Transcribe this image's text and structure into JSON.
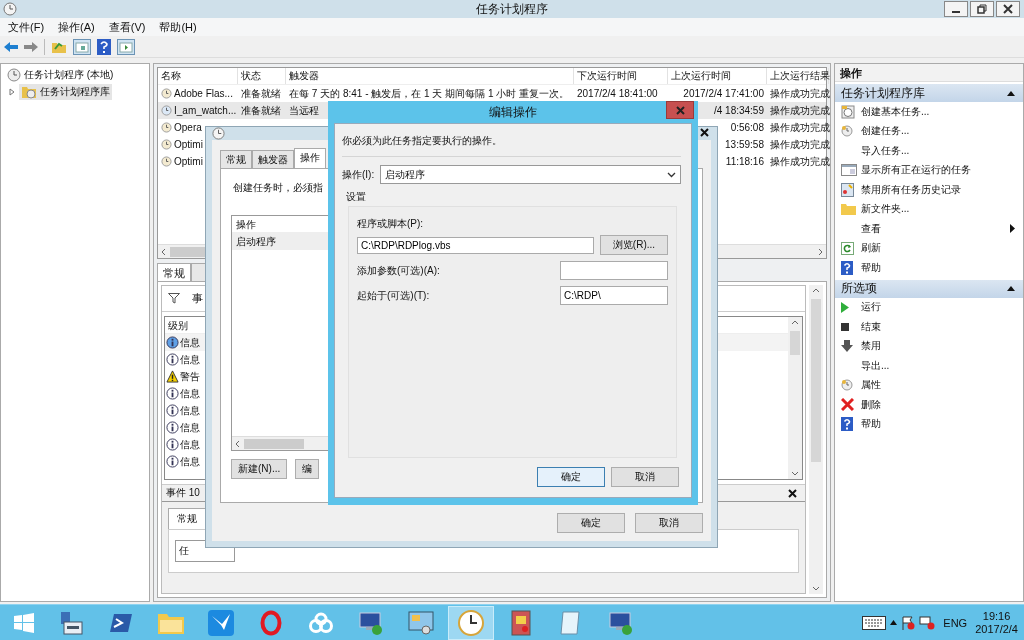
{
  "window": {
    "title": "任务计划程序"
  },
  "menu": [
    "文件(F)",
    "操作(A)",
    "查看(V)",
    "帮助(H)"
  ],
  "tree": [
    {
      "label": "任务计划程序 (本地)",
      "selected": false,
      "children": [
        {
          "label": "任务计划程序库",
          "selected": true,
          "expanded": false
        }
      ]
    }
  ],
  "task_table": {
    "columns": [
      "名称",
      "状态",
      "触发器",
      "下次运行时间",
      "上次运行时间",
      "上次运行结果"
    ],
    "rows": [
      {
        "name": "Adobe Flas...",
        "status": "准备就绪",
        "trigger": "在每 7 天的 8:41 - 触发后，在 1 天 期间每隔 1 小时 重复一次。",
        "next_run": "2017/2/4 18:41:00",
        "last_run": "2017/2/4 17:41:00",
        "result": "操作成功完成",
        "selected": false
      },
      {
        "name": "I_am_watch...",
        "status": "准备就绪",
        "trigger": "当远程",
        "last_run": "/4 18:34:59",
        "result": "操作成功完成",
        "selected": true
      },
      {
        "name": "Opera",
        "last_run": "0:56:08",
        "result": "操作成功完成",
        "selected": false
      },
      {
        "name": "Optimi",
        "last_run": "13:59:58",
        "result": "操作成功完成",
        "selected": false
      },
      {
        "name": "Optimi",
        "last_run": "11:18:16",
        "result": "操作成功完成",
        "selected": false
      }
    ]
  },
  "lower_tabs": [
    {
      "label": "常规",
      "selected": true
    }
  ],
  "events": {
    "title": "事",
    "column": "级别",
    "rows": [
      {
        "kind": "info",
        "level": "信息",
        "selected": true
      },
      {
        "kind": "info",
        "level": "信息",
        "selected": false
      },
      {
        "kind": "warning",
        "level": "警告",
        "selected": false
      },
      {
        "kind": "info",
        "level": "信息",
        "selected": false
      },
      {
        "kind": "info",
        "level": "信息",
        "selected": false
      },
      {
        "kind": "info",
        "level": "信息",
        "selected": false
      },
      {
        "kind": "info",
        "level": "信息",
        "selected": false
      },
      {
        "kind": "info",
        "level": "信息",
        "selected": false
      }
    ]
  },
  "event_detail": {
    "title": "事件 10",
    "tab": "常规",
    "field": "任"
  },
  "properties_dialog": {
    "tabs": [
      {
        "label": "常规",
        "selected": false
      },
      {
        "label": "触发器",
        "selected": false
      },
      {
        "label": "操作",
        "selected": true
      }
    ],
    "description": "创建任务时，必须指",
    "list_header": "操作",
    "list_rows": [
      "启动程序"
    ],
    "buttons": [
      "新建(N)...",
      "编"
    ],
    "footer_buttons": [
      "确定",
      "取消"
    ]
  },
  "edit_dialog": {
    "title": "编辑操作",
    "instruction": "你必须为此任务指定要执行的操作。",
    "action_label": "操作(I):",
    "action_value": "启动程序",
    "group": "设置",
    "program_label": "程序或脚本(P):",
    "program_value": "C:\\RDP\\RDPlog.vbs",
    "browse_button": "浏览(R)...",
    "args_label": "添加参数(可选)(A):",
    "start_label": "起始于(可选)(T):",
    "start_value": "C:\\RDP\\",
    "buttons": [
      {
        "label": "确定",
        "default": true
      },
      {
        "label": "取消",
        "default": false
      }
    ]
  },
  "actions_panel": {
    "title": "操作",
    "sections": [
      {
        "title": "任务计划程序库",
        "expanded": true,
        "items": [
          {
            "label": "创建基本任务...",
            "kind": "calendar"
          },
          {
            "label": "创建任务...",
            "kind": "clock"
          },
          {
            "label": "导入任务...",
            "kind": "plain"
          },
          {
            "label": "显示所有正在运行的任务",
            "kind": "window"
          },
          {
            "label": "禁用所有任务历史记录",
            "kind": "document"
          },
          {
            "label": "新文件夹...",
            "kind": "folder"
          },
          {
            "label": "查看",
            "kind": "submenu"
          },
          {
            "label": "刷新",
            "kind": "refresh"
          },
          {
            "label": "帮助",
            "kind": "help"
          }
        ]
      },
      {
        "title": "所选项",
        "expanded": true,
        "items": [
          {
            "label": "运行",
            "kind": "play"
          },
          {
            "label": "结束",
            "kind": "stop"
          },
          {
            "label": "禁用",
            "kind": "down"
          },
          {
            "label": "导出...",
            "kind": "plain"
          },
          {
            "label": "属性",
            "kind": "clock"
          },
          {
            "label": "删除",
            "kind": "delete"
          },
          {
            "label": "帮助",
            "kind": "help"
          }
        ]
      }
    ]
  },
  "taskbar": {
    "apps": [
      {
        "kind": "start",
        "active": false
      },
      {
        "kind": "server",
        "active": false
      },
      {
        "kind": "powershell",
        "active": false
      },
      {
        "kind": "folder",
        "active": false
      },
      {
        "kind": "bird",
        "active": false
      },
      {
        "kind": "ring",
        "active": false
      },
      {
        "kind": "cloud",
        "active": false
      },
      {
        "kind": "remote",
        "active": false
      },
      {
        "kind": "panel",
        "active": false
      },
      {
        "kind": "clock",
        "active": true
      },
      {
        "kind": "archive",
        "active": false
      },
      {
        "kind": "notepad",
        "active": false
      },
      {
        "kind": "remote",
        "active": false
      }
    ],
    "language": "ENG",
    "time": "19:16",
    "date": "2017/2/4"
  }
}
